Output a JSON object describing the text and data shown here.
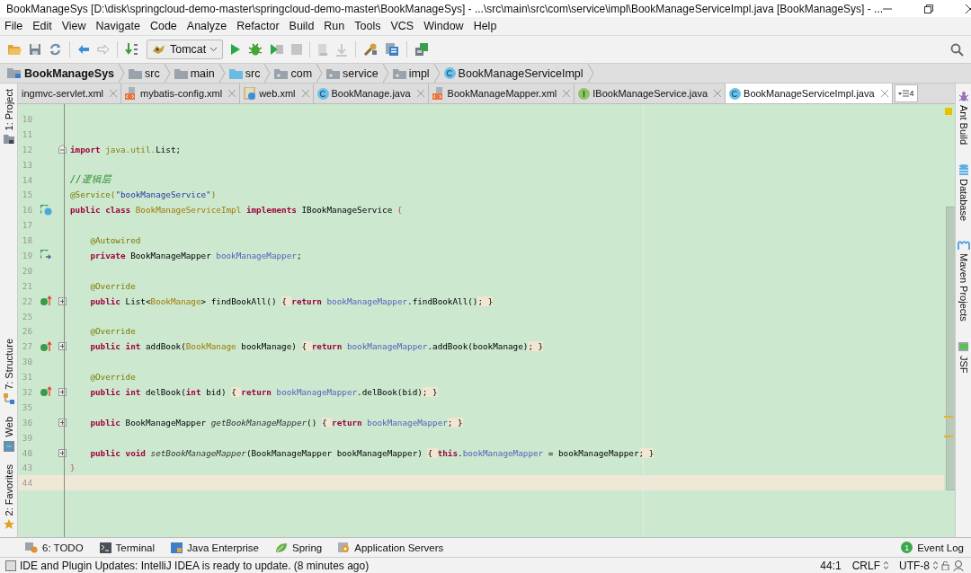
{
  "window": {
    "title": "BookManageSys [D:\\disk\\springcloud-demo-master\\springcloud-demo-master\\BookManageSys] - ...\\src\\main\\src\\com\\service\\impl\\BookManageServiceImpl.java [BookManageSys] - ..."
  },
  "menu": [
    "File",
    "Edit",
    "View",
    "Navigate",
    "Code",
    "Analyze",
    "Refactor",
    "Build",
    "Run",
    "Tools",
    "VCS",
    "Window",
    "Help"
  ],
  "toolbar": {
    "run_config": "Tomcat"
  },
  "breadcrumbs": [
    {
      "label": "BookManageSys",
      "kind": "project"
    },
    {
      "label": "src",
      "kind": "folder"
    },
    {
      "label": "main",
      "kind": "folder"
    },
    {
      "label": "src",
      "kind": "source"
    },
    {
      "label": "com",
      "kind": "package"
    },
    {
      "label": "service",
      "kind": "package"
    },
    {
      "label": "impl",
      "kind": "package"
    },
    {
      "label": "BookManageServiceImpl",
      "kind": "class"
    }
  ],
  "tabs": [
    {
      "label": "ingmvc-servlet.xml",
      "selected": false
    },
    {
      "label": "mybatis-config.xml",
      "kind": "xml",
      "selected": false
    },
    {
      "label": "web.xml",
      "kind": "web",
      "selected": false
    },
    {
      "label": "BookManage.java",
      "kind": "class",
      "selected": false
    },
    {
      "label": "BookManageMapper.xml",
      "kind": "xml",
      "selected": false
    },
    {
      "label": "IBookManageService.java",
      "kind": "interface",
      "selected": false
    },
    {
      "label": "BookManageServiceImpl.java",
      "kind": "class",
      "selected": true
    }
  ],
  "tabs_overflow": "4",
  "left_tool_windows": [
    {
      "label": "1: Project",
      "kind": "project"
    },
    {
      "label": "7: Structure",
      "kind": "structure"
    },
    {
      "label": "Web",
      "kind": "web"
    },
    {
      "label": "2: Favorites",
      "kind": "favorites"
    }
  ],
  "right_tool_windows": [
    {
      "label": "Ant Build",
      "kind": "ant"
    },
    {
      "label": "Database",
      "kind": "database"
    },
    {
      "label": "Maven Projects",
      "kind": "maven"
    },
    {
      "label": "JSF",
      "kind": "jsf"
    }
  ],
  "editor": {
    "lines": [
      {
        "number": "10",
        "current": false
      },
      {
        "number": "11",
        "current": false
      },
      {
        "number": "12",
        "fold": {
          "kind": "open"
        },
        "current": false,
        "tokens": [
          {
            "text": "import",
            "kind": "keyword"
          },
          {
            "text": " java.util.",
            "kind": "package"
          },
          {
            "text": "List;",
            "kind": "plain"
          }
        ]
      },
      {
        "number": "13",
        "current": false
      },
      {
        "number": "14",
        "current": false,
        "tokens": [
          {
            "text": "//逻辑层",
            "kind": "comment"
          }
        ]
      },
      {
        "number": "15",
        "current": false,
        "tokens": [
          {
            "text": "@Service(",
            "kind": "annotation"
          },
          {
            "text": "\"bookManageService\"",
            "kind": "string"
          },
          {
            "text": ")",
            "kind": "annotation"
          }
        ]
      },
      {
        "number": "16",
        "gutter": {
          "kind": "class"
        },
        "current": false,
        "tokens": [
          {
            "text": "public class ",
            "kind": "keyword"
          },
          {
            "text": "BookManageServiceImpl",
            "kind": "type"
          },
          {
            "text": " implements ",
            "kind": "keyword"
          },
          {
            "text": "IBookManageService ",
            "kind": "plain"
          },
          {
            "text": "{",
            "kind": "brace"
          }
        ]
      },
      {
        "number": "17",
        "current": false
      },
      {
        "number": "18",
        "current": false,
        "tokens": [
          {
            "text": "    @Autowired",
            "kind": "annotation"
          }
        ]
      },
      {
        "number": "19",
        "gutter": {
          "kind": "bean"
        },
        "current": false,
        "tokens": [
          {
            "text": "    private ",
            "kind": "keyword"
          },
          {
            "text": "BookManageMapper ",
            "kind": "plain"
          },
          {
            "text": "bookManageMapper",
            "kind": "field"
          },
          {
            "text": ";",
            "kind": "plain"
          }
        ]
      },
      {
        "number": "20",
        "current": false
      },
      {
        "number": "21",
        "current": false,
        "tokens": [
          {
            "text": "    @Override",
            "kind": "annotation"
          }
        ]
      },
      {
        "number": "22",
        "gutter": {
          "kind": "override"
        },
        "fold": {
          "kind": "collapsed"
        },
        "current": false,
        "tokens": [
          {
            "text": "    public ",
            "kind": "keyword"
          },
          {
            "text": "List<",
            "kind": "plain"
          },
          {
            "text": "BookManage",
            "kind": "type"
          },
          {
            "text": "> findBookAll() ",
            "kind": "plain"
          },
          {
            "text": "{ ",
            "kind": "folded"
          },
          {
            "text": "return ",
            "kind": "keyword"
          },
          {
            "text": "bookManageMapper",
            "kind": "field"
          },
          {
            "text": ".findBookAll()",
            "kind": "plain"
          },
          {
            "text": "; }",
            "kind": "folded"
          }
        ]
      },
      {
        "number": "25",
        "current": false
      },
      {
        "number": "26",
        "current": false,
        "tokens": [
          {
            "text": "    @Override",
            "kind": "annotation"
          }
        ]
      },
      {
        "number": "27",
        "gutter": {
          "kind": "override"
        },
        "fold": {
          "kind": "collapsed"
        },
        "current": false,
        "tokens": [
          {
            "text": "    public int ",
            "kind": "keyword"
          },
          {
            "text": "addBook(",
            "kind": "plain"
          },
          {
            "text": "BookManage",
            "kind": "type"
          },
          {
            "text": " bookManage) ",
            "kind": "plain"
          },
          {
            "text": "{ ",
            "kind": "folded"
          },
          {
            "text": "return ",
            "kind": "keyword"
          },
          {
            "text": "bookManageMapper",
            "kind": "field"
          },
          {
            "text": ".addBook(bookManage)",
            "kind": "plain"
          },
          {
            "text": "; }",
            "kind": "folded"
          }
        ]
      },
      {
        "number": "30",
        "current": false
      },
      {
        "number": "31",
        "current": false,
        "tokens": [
          {
            "text": "    @Override",
            "kind": "annotation"
          }
        ]
      },
      {
        "number": "32",
        "gutter": {
          "kind": "override"
        },
        "fold": {
          "kind": "collapsed"
        },
        "current": false,
        "tokens": [
          {
            "text": "    public int ",
            "kind": "keyword"
          },
          {
            "text": "delBook(",
            "kind": "plain"
          },
          {
            "text": "int",
            "kind": "keyword"
          },
          {
            "text": " bid) ",
            "kind": "plain"
          },
          {
            "text": "{ ",
            "kind": "folded"
          },
          {
            "text": "return ",
            "kind": "keyword"
          },
          {
            "text": "bookManageMapper",
            "kind": "field"
          },
          {
            "text": ".delBook(bid)",
            "kind": "plain"
          },
          {
            "text": "; }",
            "kind": "folded"
          }
        ]
      },
      {
        "number": "35",
        "current": false
      },
      {
        "number": "36",
        "fold": {
          "kind": "collapsed"
        },
        "current": false,
        "tokens": [
          {
            "text": "    public ",
            "kind": "keyword"
          },
          {
            "text": "BookManageMapper ",
            "kind": "plain"
          },
          {
            "text": "getBookManageMapper",
            "kind": "method"
          },
          {
            "text": "() ",
            "kind": "plain"
          },
          {
            "text": "{ ",
            "kind": "folded"
          },
          {
            "text": "return ",
            "kind": "keyword"
          },
          {
            "text": "bookManageMapper",
            "kind": "field"
          },
          {
            "text": "; }",
            "kind": "folded"
          }
        ]
      },
      {
        "number": "39",
        "current": false
      },
      {
        "number": "40",
        "fold": {
          "kind": "collapsed"
        },
        "current": false,
        "tokens": [
          {
            "text": "    public void ",
            "kind": "keyword"
          },
          {
            "text": "setBookManageMapper",
            "kind": "method"
          },
          {
            "text": "(BookManageMapper bookManageMapper) ",
            "kind": "plain"
          },
          {
            "text": "{ ",
            "kind": "folded"
          },
          {
            "text": "this",
            "kind": "keyword"
          },
          {
            "text": ".",
            "kind": "plain"
          },
          {
            "text": "bookManageMapper",
            "kind": "field"
          },
          {
            "text": " = bookManageMapper",
            "kind": "plain"
          },
          {
            "text": "; }",
            "kind": "folded"
          }
        ]
      },
      {
        "number": "43",
        "current": false,
        "tokens": [
          {
            "text": "}",
            "kind": "brace"
          }
        ]
      },
      {
        "number": "44",
        "current": true
      }
    ]
  },
  "bottom_tools": [
    {
      "label": "6: TODO",
      "kind": "todo"
    },
    {
      "label": "Terminal",
      "kind": "terminal"
    },
    {
      "label": "Java Enterprise",
      "kind": "javaee"
    },
    {
      "label": "Spring",
      "kind": "spring"
    },
    {
      "label": "Application Servers",
      "kind": "servers"
    }
  ],
  "event_log": {
    "label": "Event Log",
    "count": "1"
  },
  "status": {
    "message": "IDE and Plugin Updates: IntelliJ IDEA is ready to update. (8 minutes ago)",
    "position": "44:1",
    "line_separator": "CRLF",
    "encoding": "UTF-8"
  }
}
